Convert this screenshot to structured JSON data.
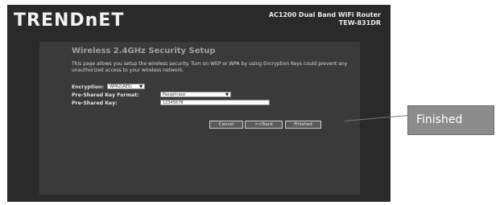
{
  "header": {
    "logo": "TRENDnET",
    "product_title": "AC1200 Dual Band WiFi Router",
    "model": "TEW-831DR"
  },
  "page": {
    "title": "Wireless 2.4GHz Security Setup",
    "description": "This page allows you setup the wireless security. Turn on WEP or WPA by using Encryption Keys could prevent any unauthorized access to your wireless network."
  },
  "form": {
    "encryption_label": "Encryption:",
    "encryption_value": "WPA2(AES)",
    "psk_format_label": "Pre-Shared Key Format:",
    "psk_format_value": "Passphrase",
    "psk_label": "Pre-Shared Key:",
    "psk_value": "12345678"
  },
  "buttons": {
    "cancel": "Cancel",
    "back": "<<Back",
    "finished": "Finished"
  },
  "callout": {
    "label": "Finished"
  }
}
